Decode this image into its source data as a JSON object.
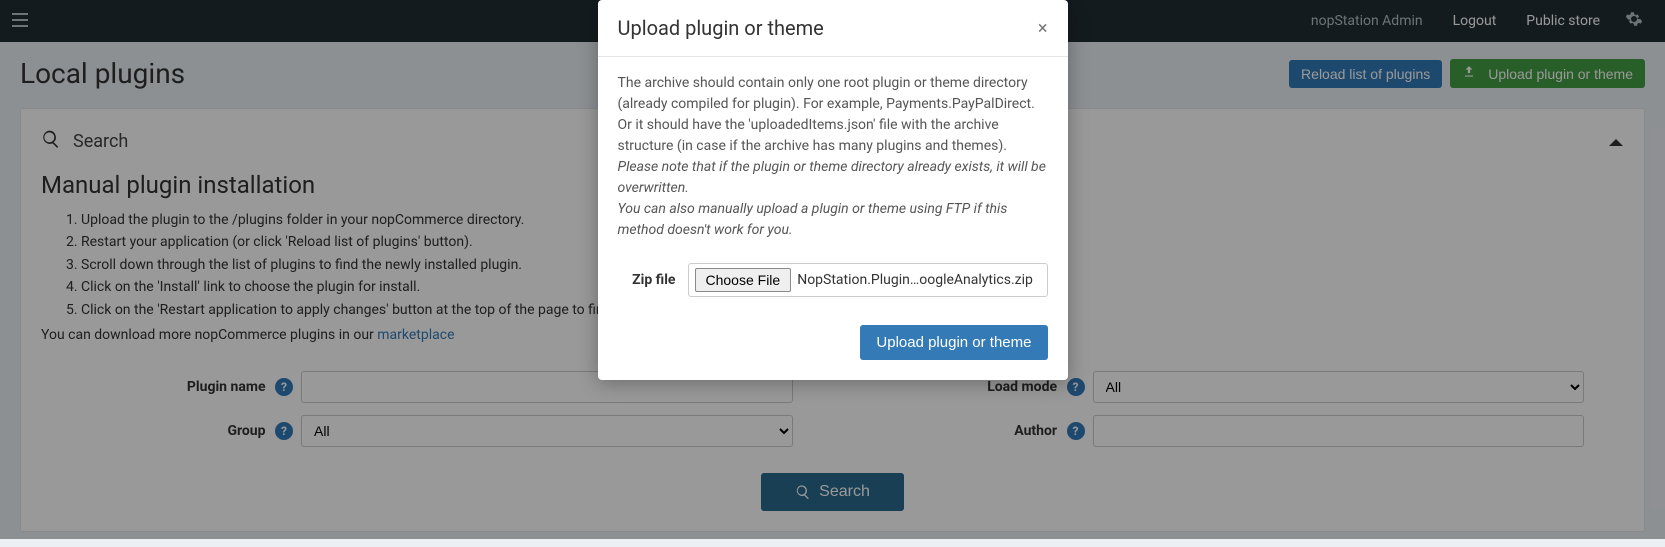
{
  "topbar": {
    "admin_label": "nopStation Admin",
    "logout_label": "Logout",
    "public_store_label": "Public store"
  },
  "page": {
    "title": "Local plugins",
    "reload_btn": "Reload list of plugins",
    "upload_btn": "Upload plugin or theme"
  },
  "search_panel": {
    "title": "Search"
  },
  "manual": {
    "title": "Manual plugin installation",
    "steps": [
      "Upload the plugin to the /plugins folder in your nopCommerce directory.",
      "Restart your application (or click 'Reload list of plugins' button).",
      "Scroll down through the list of plugins to find the newly installed plugin.",
      "Click on the 'Install' link to choose the plugin for install.",
      "Click on the 'Restart application to apply changes' button at the top of the page to finish the process."
    ],
    "marketplace_prefix": "You can download more nopCommerce plugins in our ",
    "marketplace_link": "marketplace"
  },
  "filters": {
    "plugin_name_label": "Plugin name",
    "plugin_name_value": "",
    "group_label": "Group",
    "group_value": "All",
    "load_mode_label": "Load mode",
    "load_mode_value": "All",
    "author_label": "Author",
    "author_value": "",
    "search_btn": "Search"
  },
  "modal": {
    "title": "Upload plugin or theme",
    "desc_line1": "The archive should contain only one root plugin or theme directory (already compiled for plugin). For example, Payments.PayPalDirect.",
    "desc_line2": "Or it should have the 'uploadedItems.json' file with the archive structure (in case if the archive has many plugins and themes).",
    "note_line1": "Please note that if the plugin or theme directory already exists, it will be overwritten.",
    "note_line2": "You can also manually upload a plugin or theme using FTP if this method doesn't work for you.",
    "zip_label": "Zip file",
    "choose_file_btn": "Choose File",
    "file_name": "NopStation.Plugin…oogleAnalytics.zip",
    "submit_btn": "Upload plugin or theme"
  }
}
